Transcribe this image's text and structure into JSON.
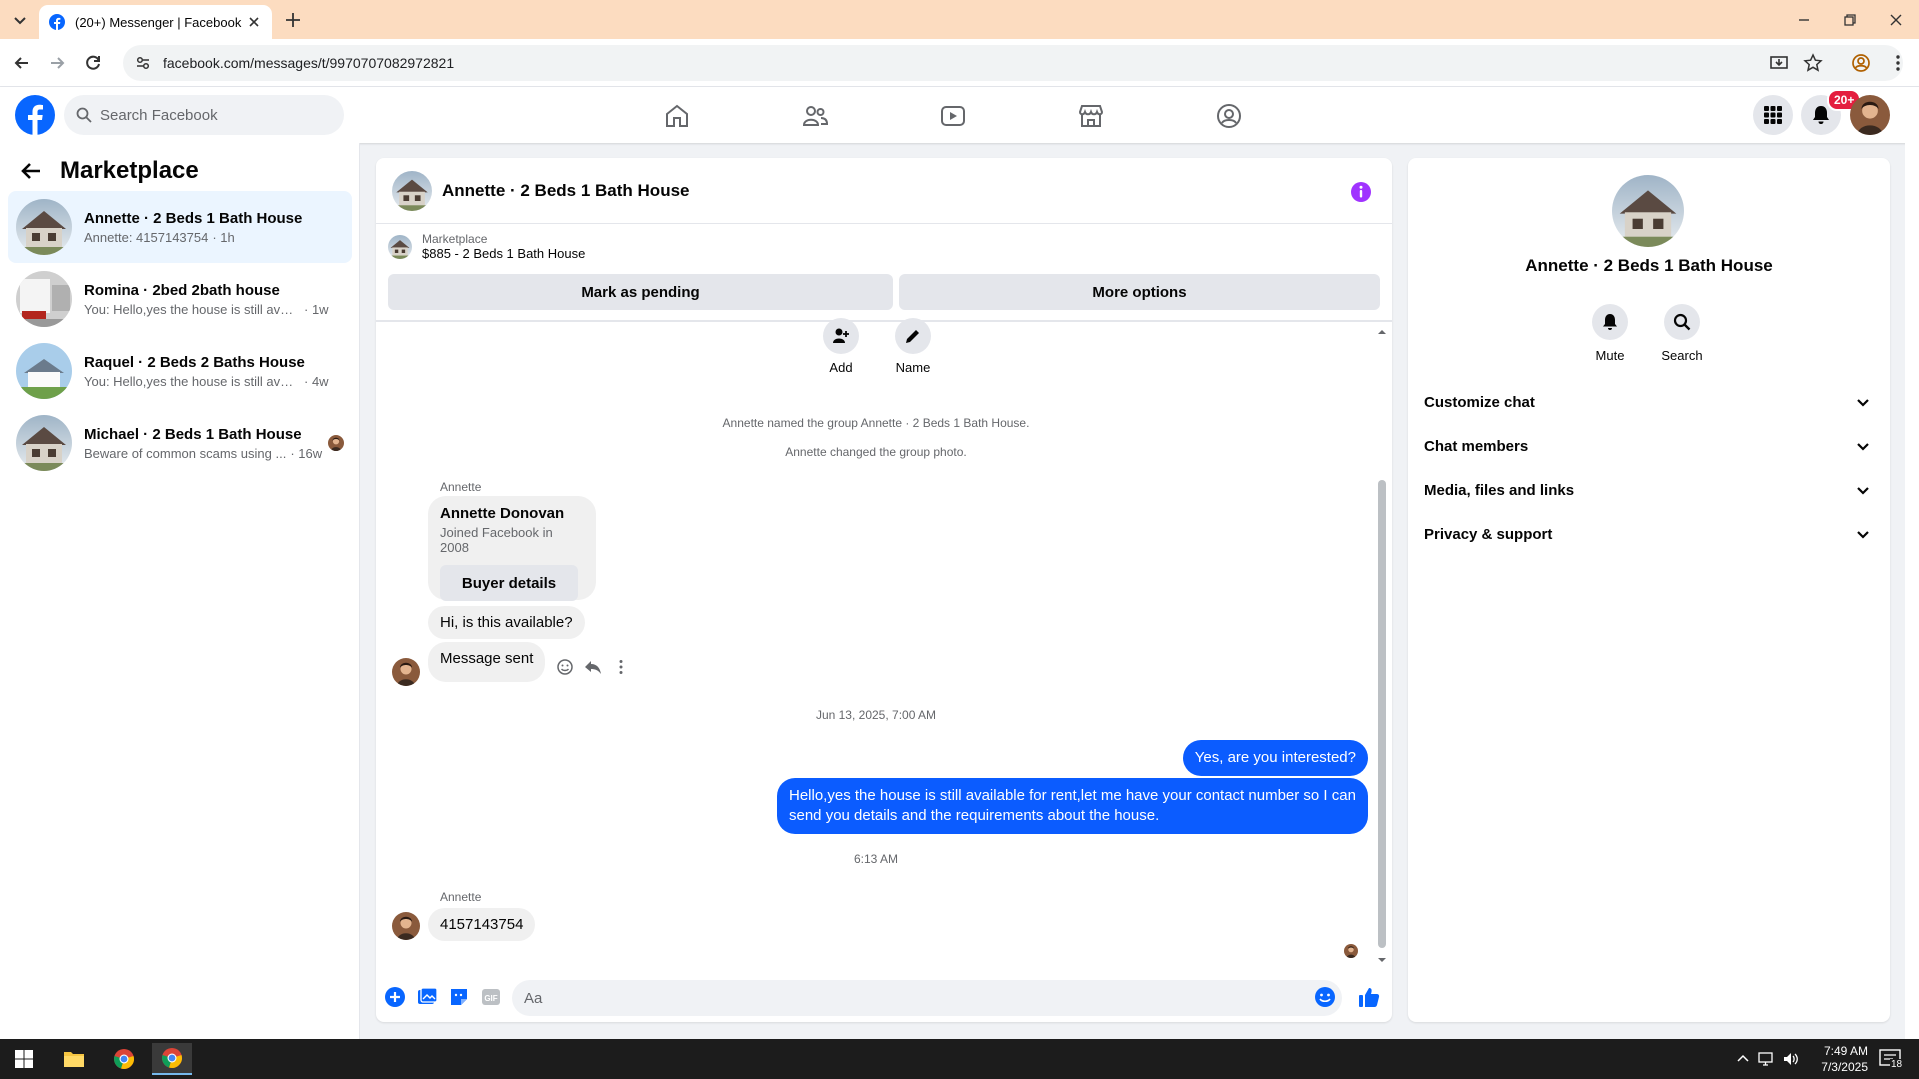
{
  "browser": {
    "tab_title": "(20+) Messenger | Facebook",
    "url": "facebook.com/messages/t/9970707082972821"
  },
  "header": {
    "search_placeholder": "Search Facebook",
    "notification_badge": "20+"
  },
  "left_panel": {
    "title": "Marketplace",
    "conversations": [
      {
        "name": "Annette · 2 Beds 1 Bath House",
        "preview": "Annette: 4157143754",
        "time": "· 1h"
      },
      {
        "name": "Romina · 2bed 2bath house",
        "preview": "You: Hello,yes the house is still availa...",
        "time": "· 1w"
      },
      {
        "name": "Raquel · 2 Beds 2 Baths House",
        "preview": "You: Hello,yes the house is still availa...",
        "time": "· 4w"
      },
      {
        "name": "Michael · 2 Beds 1 Bath House",
        "preview": "Beware of common scams using ...",
        "time": "· 16w"
      }
    ]
  },
  "chat": {
    "title": "Annette · 2 Beds 1 Bath House",
    "marketplace_label": "Marketplace",
    "listing": "$885 - 2 Beds 1 Bath House",
    "mark_pending": "Mark as pending",
    "more_options": "More options",
    "add_label": "Add",
    "name_label": "Name",
    "sys1": "Annette named the group Annette · 2 Beds 1 Bath House.",
    "sys2": "Annette changed the group photo.",
    "sender": "Annette",
    "card_name": "Annette Donovan",
    "card_sub": "Joined Facebook in 2008",
    "buyer_details": "Buyer details",
    "msg1": "Hi, is this available?",
    "msg2": "Message sent",
    "date1": "Jun 13, 2025, 7:00 AM",
    "out1": "Yes, are you interested?",
    "out2": "Hello,yes the house is still available for rent,let me have your contact number so I can send you details and the requirements about the house.",
    "time2": "6:13 AM",
    "sender2": "Annette",
    "msg3": "4157143754",
    "composer_placeholder": "Aa"
  },
  "right_panel": {
    "name": "Annette · 2 Beds 1 Bath House",
    "mute": "Mute",
    "search": "Search",
    "sections": [
      "Customize chat",
      "Chat members",
      "Media, files and links",
      "Privacy & support"
    ]
  },
  "taskbar": {
    "time": "7:49 AM",
    "date": "7/3/2025",
    "notif_count": "18"
  },
  "colors": {
    "brand": "#0866ff",
    "outgoing_bubble": "#0b5cff",
    "accent_purple": "#a033ff",
    "badge": "#e41e3f"
  }
}
